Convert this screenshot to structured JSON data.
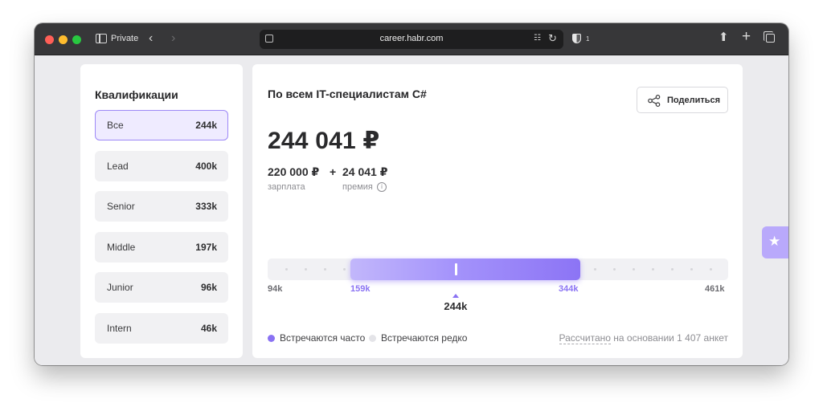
{
  "browser": {
    "mode_label": "Private",
    "url": "career.habr.com",
    "tracker_count": "1",
    "icons": [
      "sidebar-icon",
      "back-arrow-icon",
      "forward-arrow-icon",
      "page-icon",
      "translate-icon",
      "reload-icon",
      "shield-icon",
      "share-icon",
      "new-tab-icon",
      "tabs-overview-icon"
    ]
  },
  "qualifications": {
    "title": "Квалификации",
    "items": [
      {
        "label": "Все",
        "value": "244k",
        "active": true
      },
      {
        "label": "Lead",
        "value": "400k",
        "active": false
      },
      {
        "label": "Senior",
        "value": "333k",
        "active": false
      },
      {
        "label": "Middle",
        "value": "197k",
        "active": false
      },
      {
        "label": "Junior",
        "value": "96k",
        "active": false
      },
      {
        "label": "Intern",
        "value": "46k",
        "active": false
      }
    ]
  },
  "main": {
    "title": "По всем IT-специалистам C#",
    "share_label": "Поделиться",
    "total": "244 041 ₽",
    "salary": "220 000 ₽",
    "plus": "+",
    "bonus": "24 041 ₽",
    "salary_caption": "зарплата",
    "bonus_caption": "премия",
    "info_glyph": "i",
    "range": {
      "min_label": "94k",
      "low_label": "159k",
      "high_label": "344k",
      "max_label": "461k",
      "median_label": "244k",
      "min": 94,
      "low": 159,
      "median": 244,
      "high": 344,
      "max": 461
    },
    "legend": {
      "frequent": "Встречаются часто",
      "rare": "Встречаются редко"
    },
    "calc": {
      "link": "Рассчитано",
      "rest": " на основании 1 407 анкет"
    }
  },
  "colors": {
    "accent": "#8a72f3",
    "accent_light": "#c2b7fb",
    "rare_dot": "#e4e4e8",
    "favorite_tab": "#b9a9fb"
  },
  "favorite": {
    "icon": "star-icon"
  }
}
